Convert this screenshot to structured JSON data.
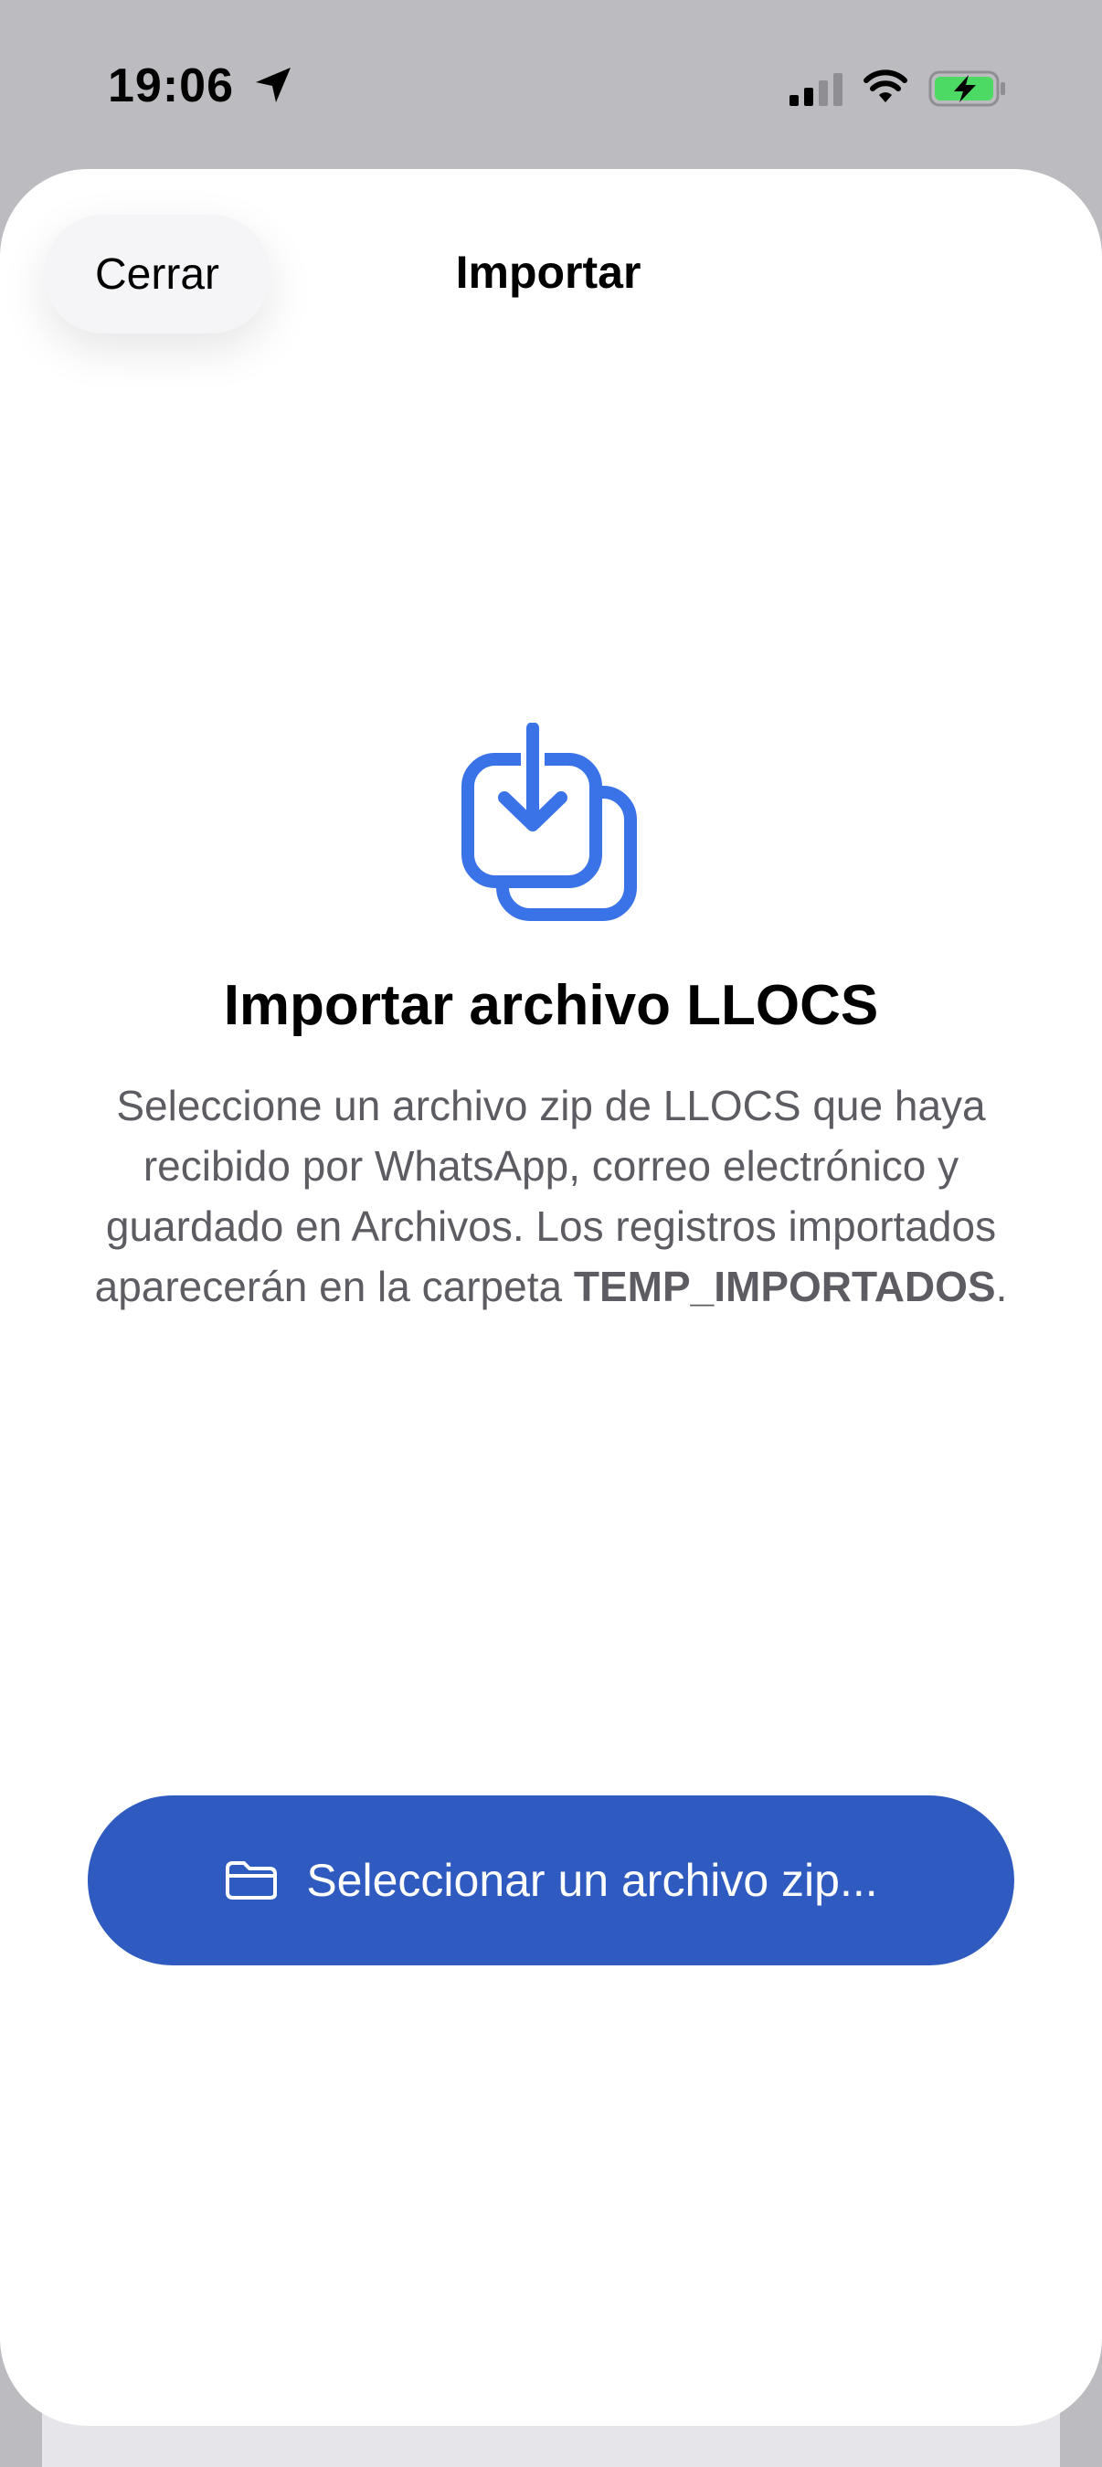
{
  "status_bar": {
    "time": "19:06",
    "icons": [
      "location-arrow-icon",
      "cellular-signal-icon",
      "wifi-icon",
      "battery-charging-icon"
    ]
  },
  "sheet": {
    "close_label": "Cerrar",
    "title": "Importar"
  },
  "content": {
    "icon": "import-download-icon",
    "heading": "Importar archivo LLOCS",
    "description_text": "Seleccione un archivo zip de LLOCS que haya recibido por WhatsApp, correo electrónico y guardado en Archivos. Los registros importados aparecerán en la carpeta",
    "description_folder": "TEMP_IMPORTADOS",
    "description_end": "."
  },
  "action": {
    "icon": "folder-icon",
    "label": "Seleccionar un archivo zip..."
  },
  "colors": {
    "accent": "#2f5bc0",
    "icon_blue": "#3a72e8",
    "battery_green": "#4cd964"
  }
}
